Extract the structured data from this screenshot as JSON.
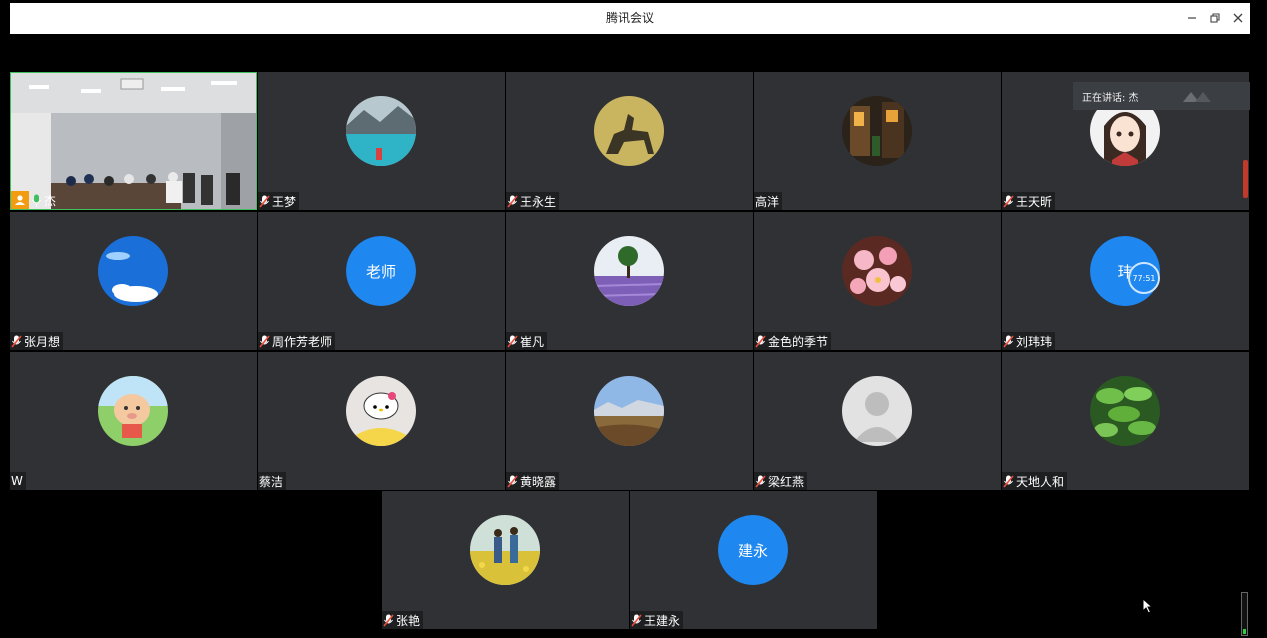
{
  "window": {
    "title": "腾讯会议",
    "minimize_icon": "minimize-icon",
    "restore_icon": "restore-icon",
    "close_icon": "close-icon"
  },
  "speaker": {
    "label": "正在讲话: 杰"
  },
  "participants": [
    {
      "name": "杰",
      "mic": "mic-on-icon",
      "avatar": "video-feed-meeting-room",
      "host": true
    },
    {
      "name": "王梦",
      "mic": "mic-muted-icon",
      "avatar": "photo-lake-mountain"
    },
    {
      "name": "王永生",
      "mic": "mic-muted-icon",
      "avatar": "photo-horse-rider-silhouette"
    },
    {
      "name": "高洋",
      "mic": "",
      "avatar": "photo-night-street"
    },
    {
      "name": "王天昕",
      "mic": "mic-muted-icon",
      "avatar": "photo-anime-girl"
    },
    {
      "name": "张月想",
      "mic": "mic-muted-icon",
      "avatar": "photo-blue-sky-clouds"
    },
    {
      "name": "周作芳老师",
      "mic": "mic-muted-icon",
      "avatar_text": "老师"
    },
    {
      "name": "崔凡",
      "mic": "mic-muted-icon",
      "avatar": "photo-lavender-tree"
    },
    {
      "name": "金色的季节",
      "mic": "mic-muted-icon",
      "avatar": "photo-pink-flowers"
    },
    {
      "name": "刘玮玮",
      "mic": "mic-muted-icon",
      "avatar_text": "玮",
      "badge": "77:51"
    },
    {
      "name": "W",
      "mic": "",
      "avatar": "photo-cartoon-pig"
    },
    {
      "name": "蔡洁",
      "mic": "",
      "avatar": "photo-hello-kitty"
    },
    {
      "name": "黄晓露",
      "mic": "mic-muted-icon",
      "avatar": "photo-mountain-valley"
    },
    {
      "name": "梁红燕",
      "mic": "mic-muted-icon",
      "avatar": "default-person-icon"
    },
    {
      "name": "天地人和",
      "mic": "mic-muted-icon",
      "avatar": "photo-green-leaves"
    },
    {
      "name": "张艳",
      "mic": "mic-muted-icon",
      "avatar": "photo-sunflower-field"
    },
    {
      "name": "王建永",
      "mic": "mic-muted-icon",
      "avatar_text": "建永"
    }
  ],
  "colors": {
    "accent_blue": "#1e87f0",
    "tile_bg": "#2f3134",
    "active_border": "#3fbf5f",
    "muted_red": "#e74c3c",
    "level_green": "#2ecc40"
  },
  "audio_level": 0.12
}
